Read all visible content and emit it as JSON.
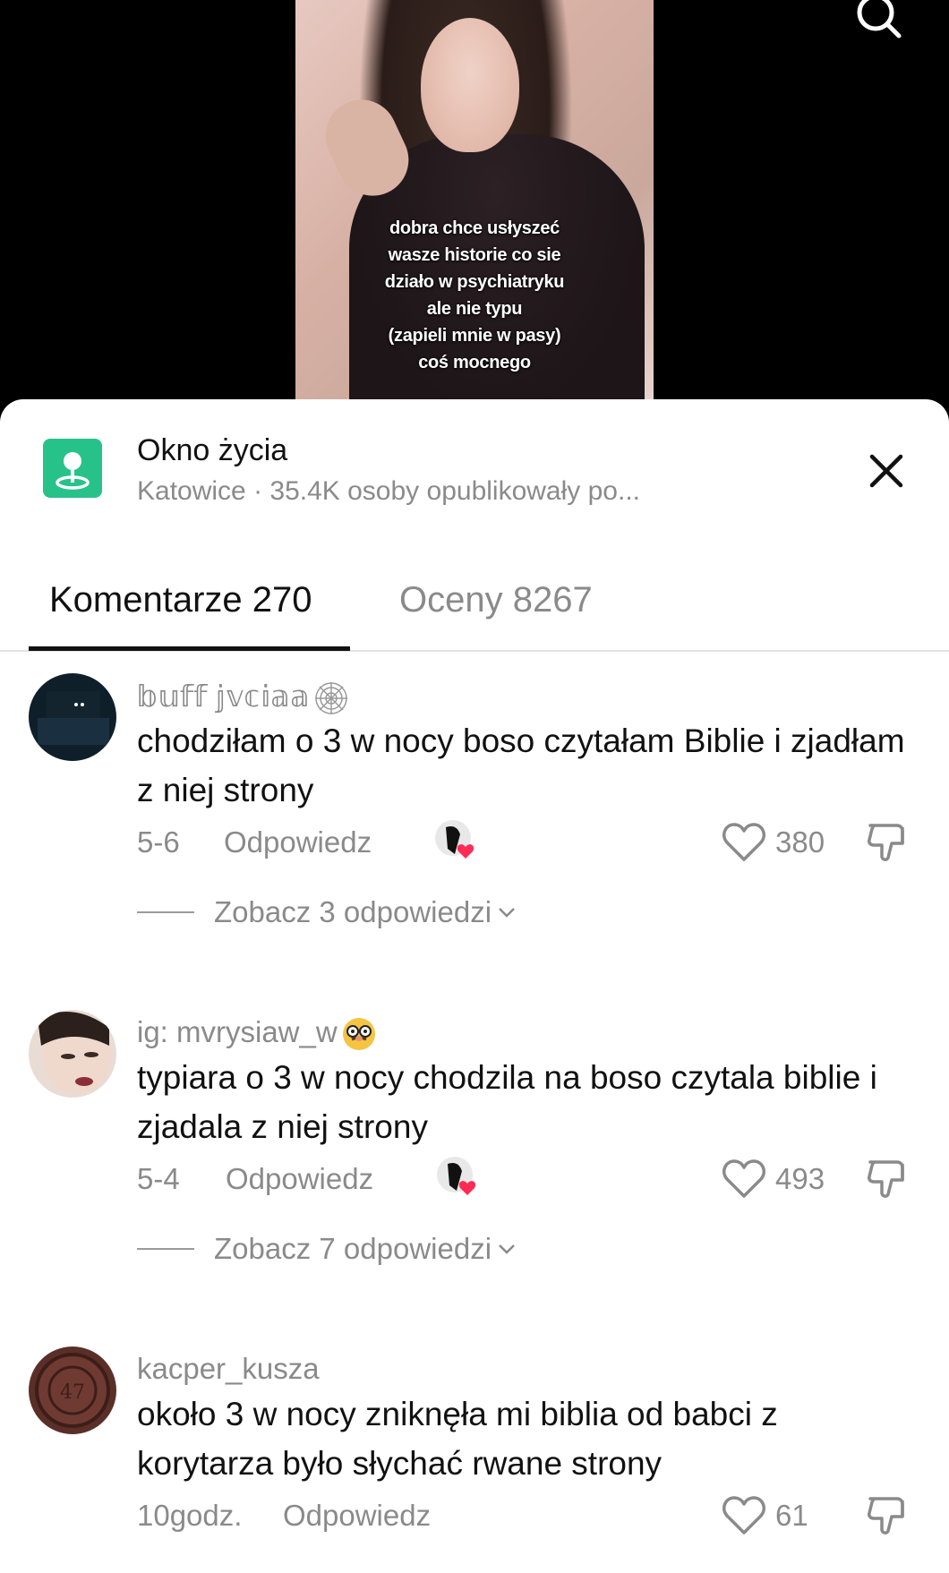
{
  "video": {
    "caption_lines": [
      "dobra chce usłyszeć",
      "wasze historie co sie",
      "działo w psychiatryku",
      "ale nie typu",
      "(zapieli mnie w pasy)",
      "coś mocnego"
    ]
  },
  "location": {
    "title": "Okno życia",
    "subtitle": "Katowice · 35.4K osoby opublikowały po..."
  },
  "tabs": [
    {
      "label": "Komentarze 270",
      "active": true
    },
    {
      "label": "Oceny 8267",
      "active": false
    }
  ],
  "comments": [
    {
      "username": "𝕓𝕦𝕗𝕗 𝕛𝕧𝕔𝕚𝕒𝕒",
      "username_emoji": "spider-web",
      "text": "chodziłam o 3 w nocy boso czytałam Biblie i zjadłam z niej strony",
      "date": "5-6",
      "reply_label": "Odpowiedz",
      "likes": "380",
      "view_replies": "Zobacz 3 odpowiedzi"
    },
    {
      "username": "ig: mvrysiaw_w",
      "username_emoji": "disguised-face",
      "text": "typiara o 3 w nocy chodzila na boso czytala biblie i zjadala z niej strony",
      "date": "5-4",
      "reply_label": "Odpowiedz",
      "likes": "493",
      "view_replies": "Zobacz 7 odpowiedzi"
    },
    {
      "username": "kacper_kusza",
      "text": "około 3 w nocy zniknęła mi biblia od babci z korytarza było słychać rwane strony",
      "date": "10godz.",
      "reply_label": "Odpowiedz",
      "likes": "61"
    }
  ],
  "colors": {
    "accent_green": "#27c28a",
    "heart_red": "#fe2c55",
    "text_primary": "#111111",
    "text_secondary": "#8a8a8a"
  }
}
